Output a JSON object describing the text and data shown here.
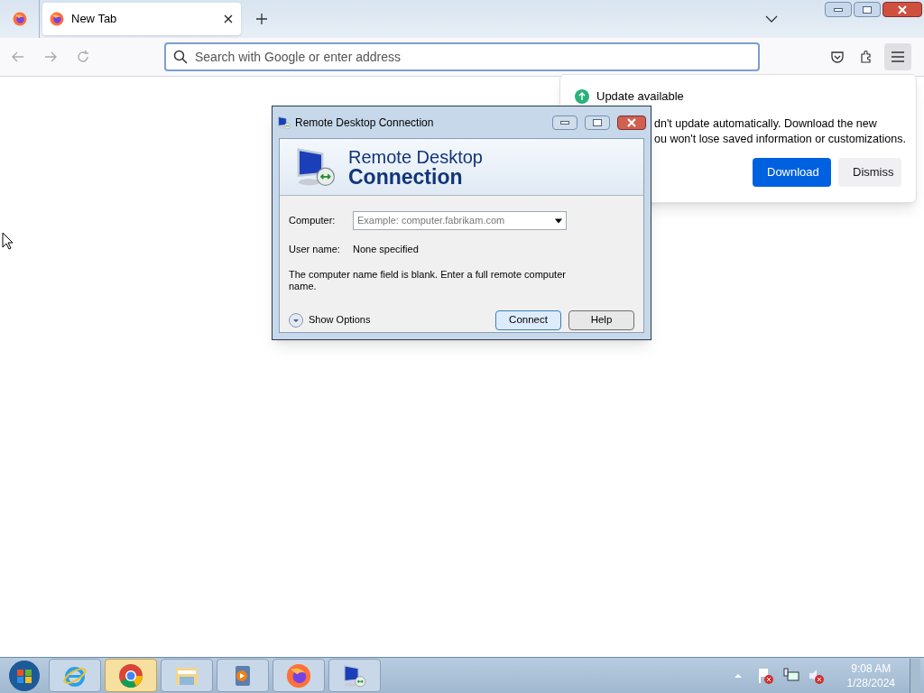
{
  "browser": {
    "tabs": [
      {
        "title": "New Tab",
        "selected": true
      }
    ],
    "address_bar": {
      "placeholder": "Search with Google or enter address"
    }
  },
  "update_popup": {
    "title": "Update available",
    "lines": [
      "dn't update automatically. Download the new",
      "ou won't lose saved information or customizations."
    ],
    "buttons": [
      {
        "label": "Download",
        "kind": "primary"
      },
      {
        "label": "Dismiss",
        "kind": "secondary"
      }
    ]
  },
  "dialog": {
    "title": "Remote Desktop Connection",
    "banner": [
      "Remote Desktop",
      "Connection"
    ],
    "computer_label": "Computer:",
    "computer_placeholder": "Example: computer.fabrikam.com",
    "user_label": "User name:",
    "user_value": "None specified",
    "message": "The computer name field is blank. Enter a full remote computer name.",
    "options_label": "Show Options",
    "buttons": [
      {
        "label": "Connect",
        "default": true
      },
      {
        "label": "Help",
        "default": false
      }
    ]
  },
  "taskbar": {
    "apps": [
      {
        "kind": "ie",
        "highlighted": false
      },
      {
        "kind": "chrome",
        "highlighted": true
      },
      {
        "kind": "explorer",
        "highlighted": false
      },
      {
        "kind": "media",
        "highlighted": false
      },
      {
        "kind": "firefox",
        "highlighted": false
      },
      {
        "kind": "rdp",
        "highlighted": false
      }
    ],
    "time": "9:08 AM",
    "date": "1/28/2024"
  }
}
